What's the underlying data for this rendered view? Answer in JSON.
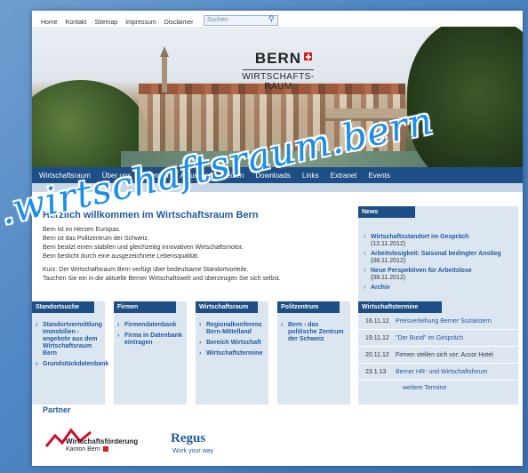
{
  "topnav": {
    "items": [
      "Home",
      "Kontakt",
      "Sitemap",
      "Impressum",
      "Disclaimer"
    ],
    "search_placeholder": "Suchen",
    "search_icon": "search-icon"
  },
  "banner": {
    "logo_title": "BERN",
    "logo_line1": "WIRTSCHAFTS-",
    "logo_line2": "RAUM"
  },
  "mainnav": {
    "items": [
      "Wirtschaftsraum",
      "Über uns",
      "Themen",
      "Aktuelles",
      "Medien",
      "Downloads",
      "Links",
      "Extranet",
      "Events"
    ]
  },
  "welcome": {
    "title": "Herzlich willkommen im Wirtschaftsraum Bern",
    "lines": [
      "Bern ist im Herzen Europas.",
      "Bern ist das Politzentrum der Schweiz.",
      "Bern besitzt einen stabilen und gleichzeitig innovativen Wirtschaftsmotor.",
      "Bern besticht durch eine ausgezeichnete Lebensqualität.",
      "Kurz: Der Wirtschaftsraum Bern verfügt über bedeutsame Standortvorteile.",
      "Tauchen Sie ein in die aktuelle Berner Wirtschaftswelt und überzeugen Sie sich selbst."
    ]
  },
  "news": {
    "header": "News",
    "items": [
      {
        "title": "Wirtschaftsstandort im Gespräch",
        "date": "(12.11.2012)"
      },
      {
        "title": "Arbeitslosigkeit: Saisonal bedingter Anstieg",
        "date": "(08.11.2012)"
      },
      {
        "title": "Neue Perspektiven für Arbeitslose",
        "date": "(08.11.2012)"
      },
      {
        "title": "Archiv",
        "date": ""
      }
    ]
  },
  "boxes": [
    {
      "header": "Standortsuche",
      "items": [
        "Standortvermittlung Immobilien - angebote aus dem Wirtschaftsraum Bern",
        "Grundstückdatenbank"
      ]
    },
    {
      "header": "Firmen",
      "items": [
        "Firmendatenbank",
        "Firma in Datenbank eintragen"
      ]
    },
    {
      "header": "Wirtschaftsraum",
      "items": [
        "Regionalkonferenz Bern-Mittelland",
        "Bereich Wirtschaft",
        "Wirtschaftstermine"
      ]
    },
    {
      "header": "Politzentrum",
      "items": [
        "Bern - das politische Zentrum der Schweiz"
      ]
    }
  ],
  "termine": {
    "header": "Wirtschaftstermine",
    "rows": [
      {
        "date": "16.11.12",
        "text": "Preisverleihung Berner Sozialstern",
        "link": true
      },
      {
        "date": "19.11.12",
        "text": "\"Der Bund\" im Gespräch",
        "link": true
      },
      {
        "date": "20.11.12",
        "text": "Firmen stellen sich vor: Accor Hotel",
        "link": false
      },
      {
        "date": "23.1.13",
        "text": "Berner HR- und Wirtschaftsforum",
        "link": true
      }
    ],
    "more": "weitere Termine"
  },
  "partner": {
    "title": "Partner",
    "wf_name": "Wirtschaftsförderung",
    "wf_sub": "Kanton Bern",
    "regus_name": "Regus",
    "regus_tagline": "Work your way"
  },
  "watermark": ".wirtschaftsraum.bern",
  "colors": {
    "brand_blue": "#1d4f86",
    "link_blue": "#1f5aa0",
    "panel": "#dce6f1",
    "watermark": "#1a8ee8"
  }
}
